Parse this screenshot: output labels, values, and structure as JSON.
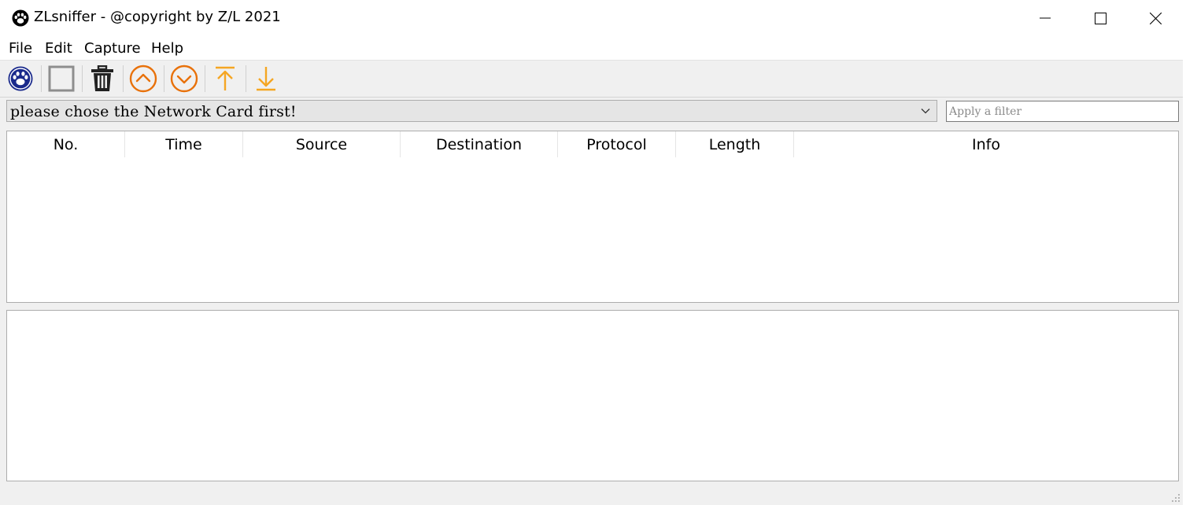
{
  "window": {
    "title": "ZLsniffer - @copyright by Z/L 2021"
  },
  "menu": {
    "items": [
      "File",
      "Edit",
      "Capture",
      "Help"
    ]
  },
  "toolbar": {
    "icons": [
      "start-capture-icon",
      "stop-capture-icon",
      "clear-icon",
      "scroll-up-icon",
      "scroll-down-icon",
      "scroll-to-top-icon",
      "scroll-to-bottom-icon"
    ]
  },
  "nic_selector": {
    "value": "please chose the Network Card first!"
  },
  "filter": {
    "placeholder": "Apply a filter"
  },
  "packet_table": {
    "columns": [
      "No.",
      "Time",
      "Source",
      "Destination",
      "Protocol",
      "Length",
      "Info"
    ],
    "rows": []
  },
  "colors": {
    "accent_orange": "#e8710a",
    "scroll_orange": "#f5a623",
    "logo_blue": "#1a2a8c"
  }
}
